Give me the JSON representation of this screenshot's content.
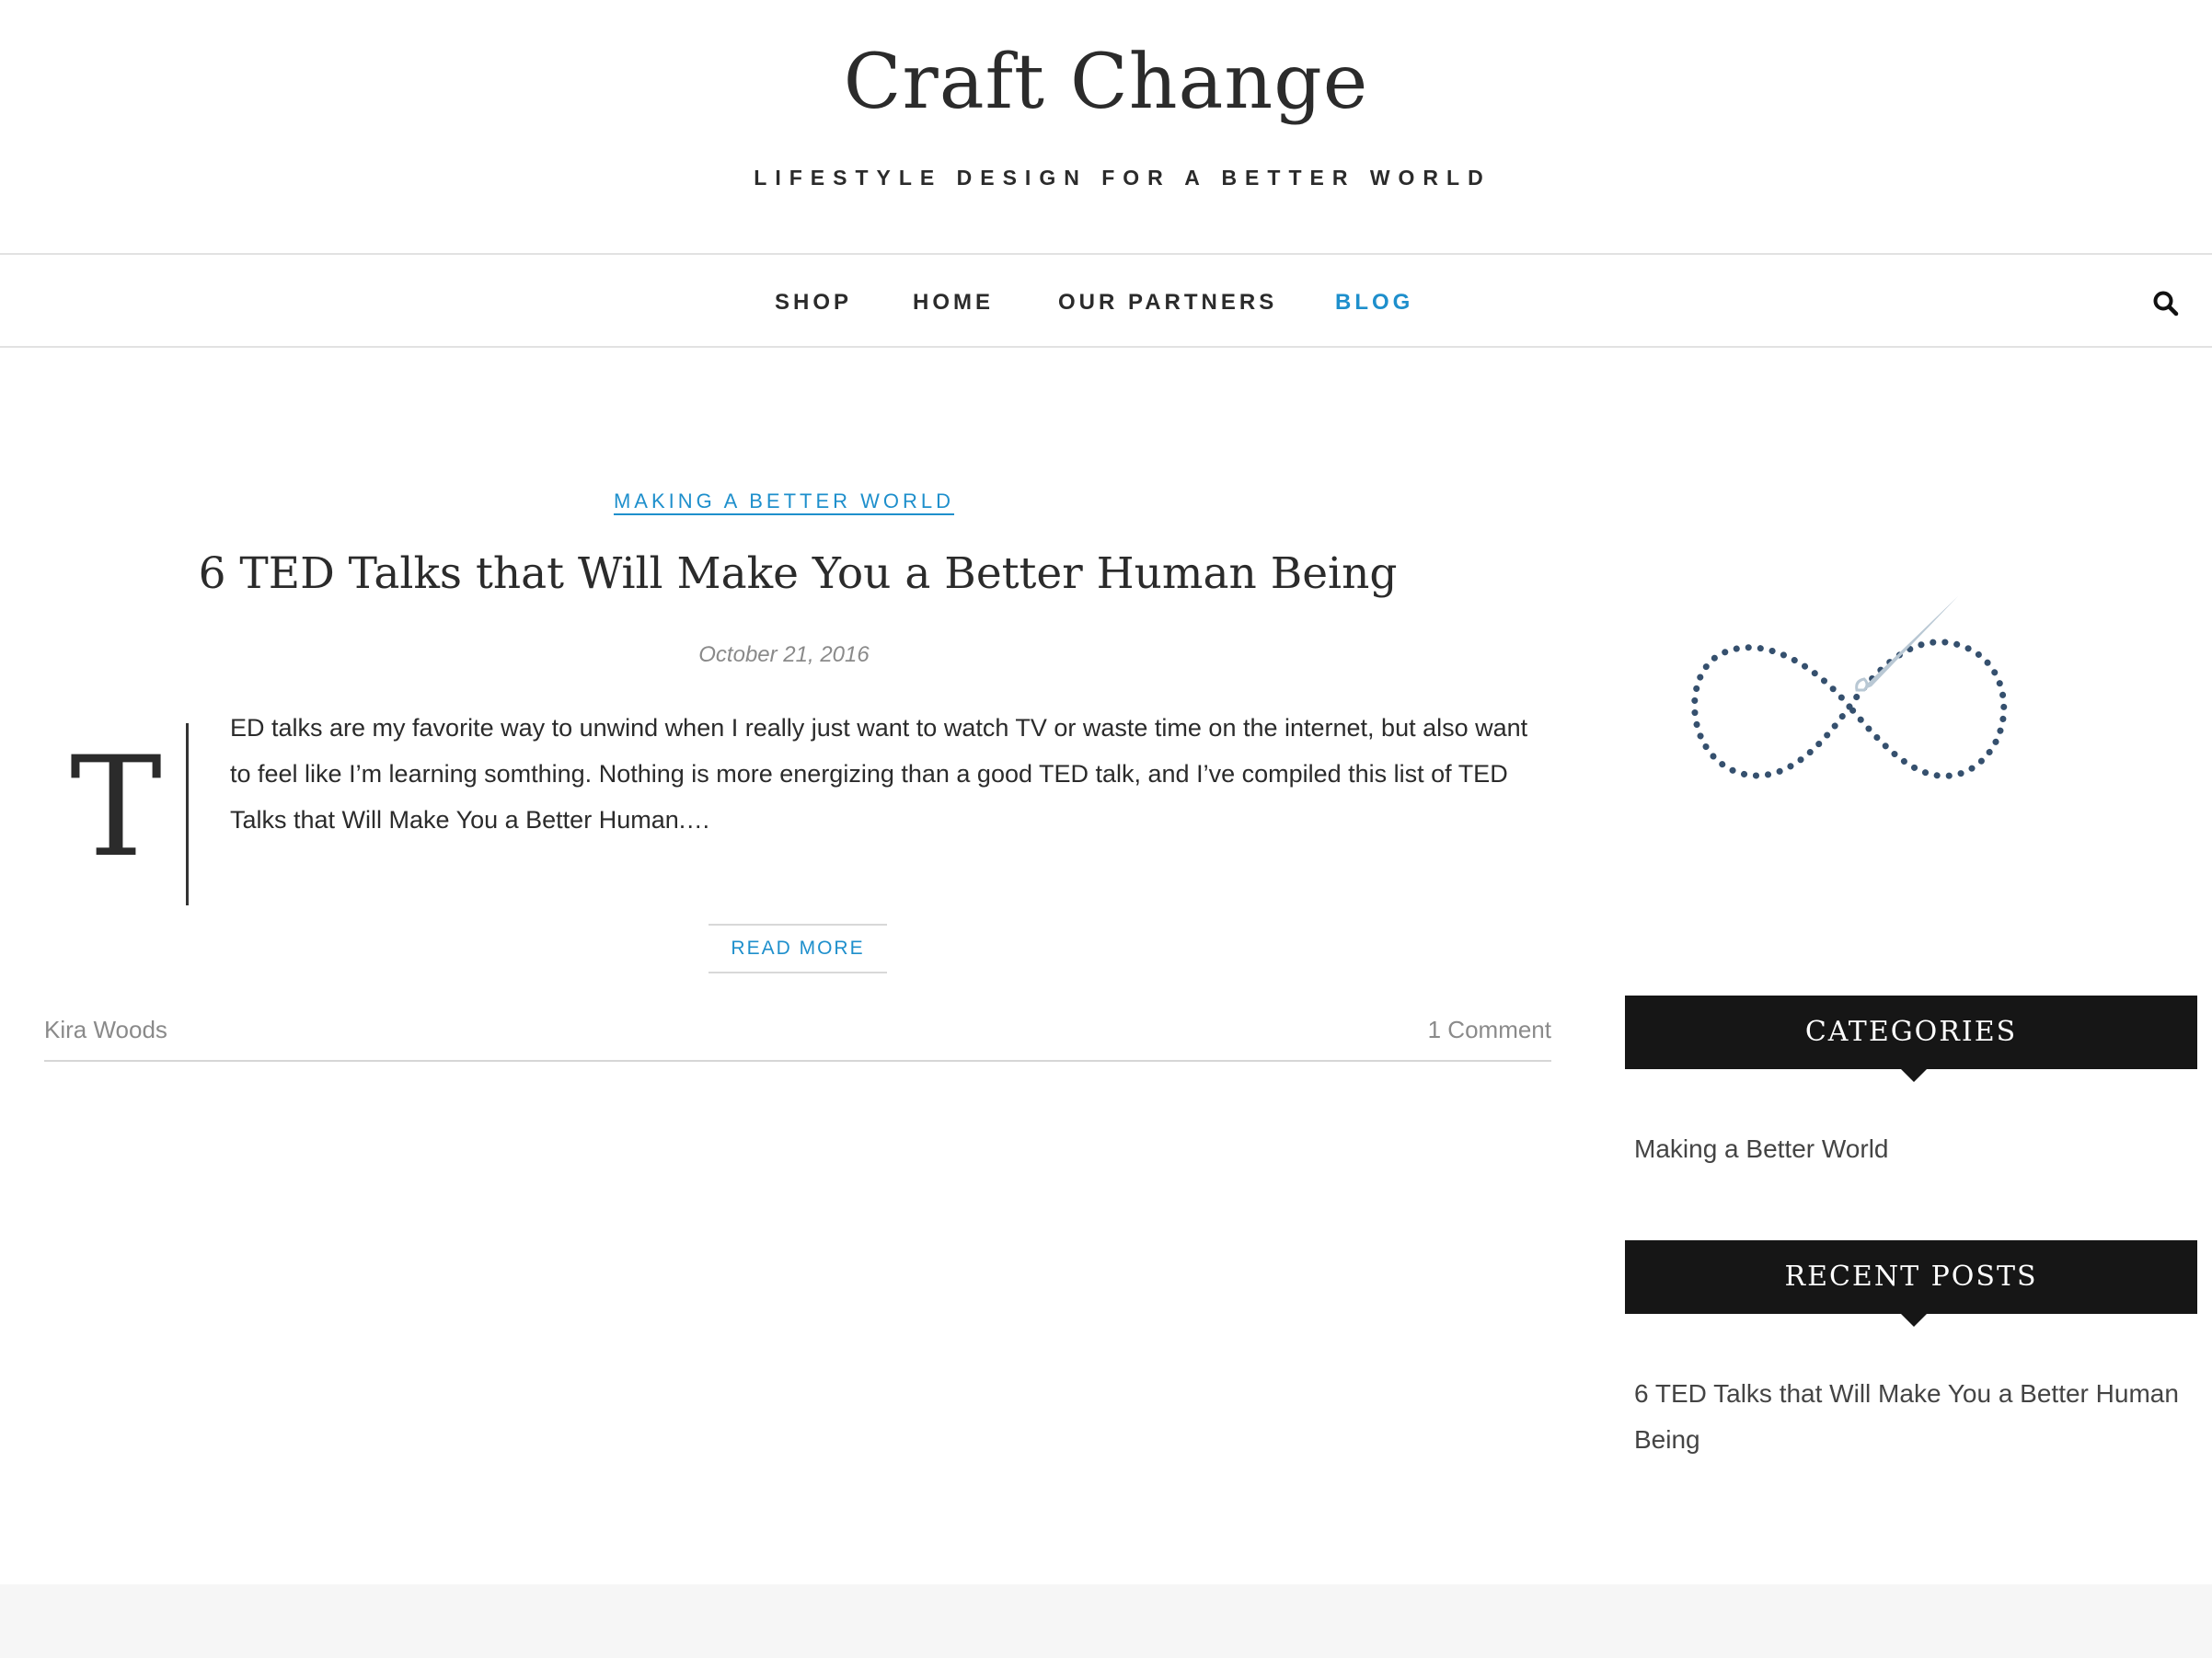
{
  "site": {
    "title": "Craft Change",
    "tagline": "LIFESTYLE DESIGN FOR A BETTER WORLD"
  },
  "nav": {
    "items": [
      {
        "label": "SHOP"
      },
      {
        "label": "HOME"
      },
      {
        "label": "OUR PARTNERS"
      },
      {
        "label": "BLOG",
        "active": true
      }
    ],
    "search_icon": "search-icon"
  },
  "post": {
    "category": "MAKING A BETTER WORLD",
    "title": "6 TED Talks that Will Make You a Better Human Being",
    "date": "October 21, 2016",
    "drop_cap": "T",
    "excerpt": "ED talks are my favorite way to unwind when I really just want to watch TV or waste time on the internet, but also want to feel like I’m learning somthing. Nothing is more energizing than a good TED talk, and I’ve compiled this list of TED Talks that Will Make You a Better Human.…",
    "read_more": "READ MORE",
    "author": "Kira Woods",
    "comments": "1 Comment"
  },
  "sidebar": {
    "logo_icon": "infinity-needle-icon",
    "categories": {
      "heading": "CATEGORIES",
      "items": [
        "Making a Better World"
      ]
    },
    "recent_posts": {
      "heading": "RECENT POSTS",
      "items": [
        "6 TED Talks that Will Make You a Better Human Being"
      ]
    }
  },
  "colors": {
    "accent": "#1e8fcc",
    "text": "#2b2b2b",
    "widget_bg": "#161616",
    "logo": "#35506e"
  }
}
